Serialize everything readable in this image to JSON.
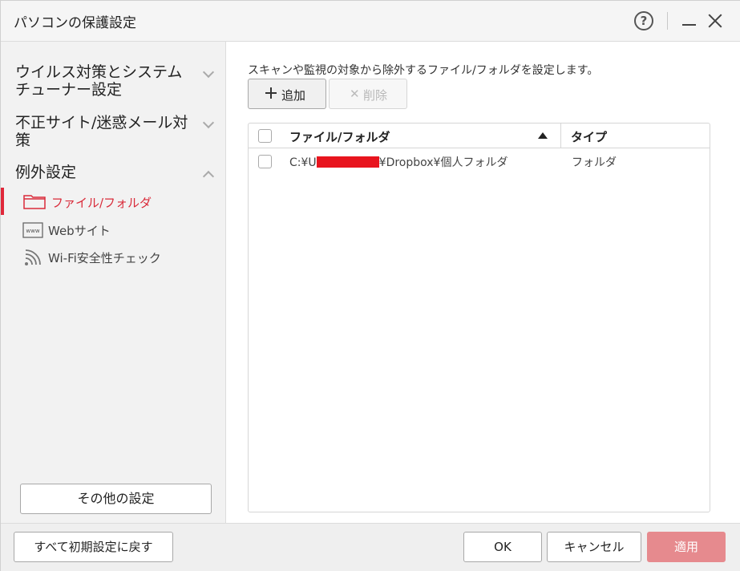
{
  "window": {
    "title": "パソコンの保護設定",
    "help_label": "?"
  },
  "sidebar": {
    "groups": [
      {
        "label": "ウイルス対策とシステムチューナー設定",
        "state": "collapsed"
      },
      {
        "label": "不正サイト/迷惑メール対策",
        "state": "collapsed"
      },
      {
        "label": "例外設定",
        "state": "expanded"
      }
    ],
    "sub_items": [
      {
        "label": "ファイル/フォルダ",
        "icon": "folder-icon",
        "active": true
      },
      {
        "label": "Webサイト",
        "icon": "www-icon",
        "active": false
      },
      {
        "label": "Wi-Fi安全性チェック",
        "icon": "wifi-icon",
        "active": false
      }
    ],
    "other_settings_label": "その他の設定"
  },
  "main": {
    "description": "スキャンや監視の対象から除外するファイル/フォルダを設定します。",
    "add_label": "追加",
    "delete_label": "削除",
    "table": {
      "columns": [
        "ファイル/フォルダ",
        "タイプ"
      ],
      "sort": "ascending",
      "rows": [
        {
          "path_prefix": "C:¥U",
          "path_suffix": "¥Dropbox¥個人フォルダ",
          "type": "フォルダ"
        }
      ]
    }
  },
  "footer": {
    "reset_label": "すべて初期設定に戻す",
    "ok_label": "OK",
    "cancel_label": "キャンセル",
    "apply_label": "適用"
  },
  "colors": {
    "accent": "#e0283a",
    "apply_disabled": "#e68a8e",
    "redaction": "#e8141e"
  }
}
